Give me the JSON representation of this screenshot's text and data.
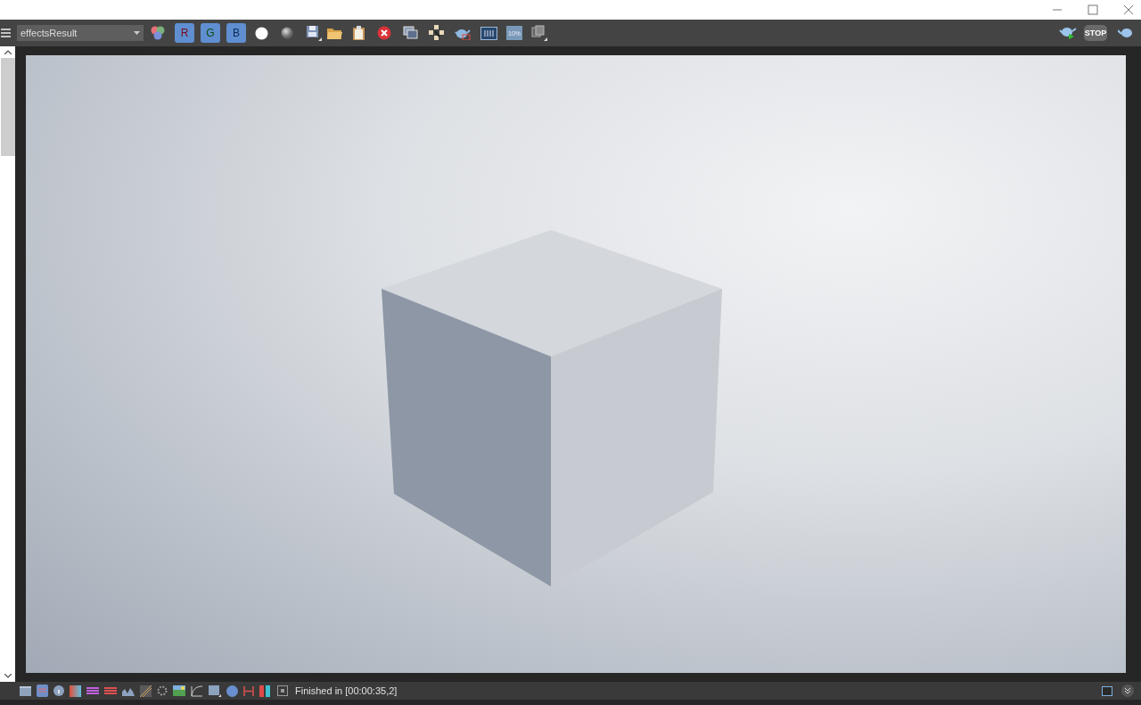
{
  "toolbar": {
    "channel_select": {
      "value": "effectsResult"
    },
    "channels": [
      {
        "label": "R",
        "selected": true
      },
      {
        "label": "G",
        "selected": true
      },
      {
        "label": "B",
        "selected": true
      }
    ],
    "zoom_badge": "10%",
    "stop_label": "STOP"
  },
  "status_bar": {
    "message": "Finished in [00:00:35,2]"
  }
}
